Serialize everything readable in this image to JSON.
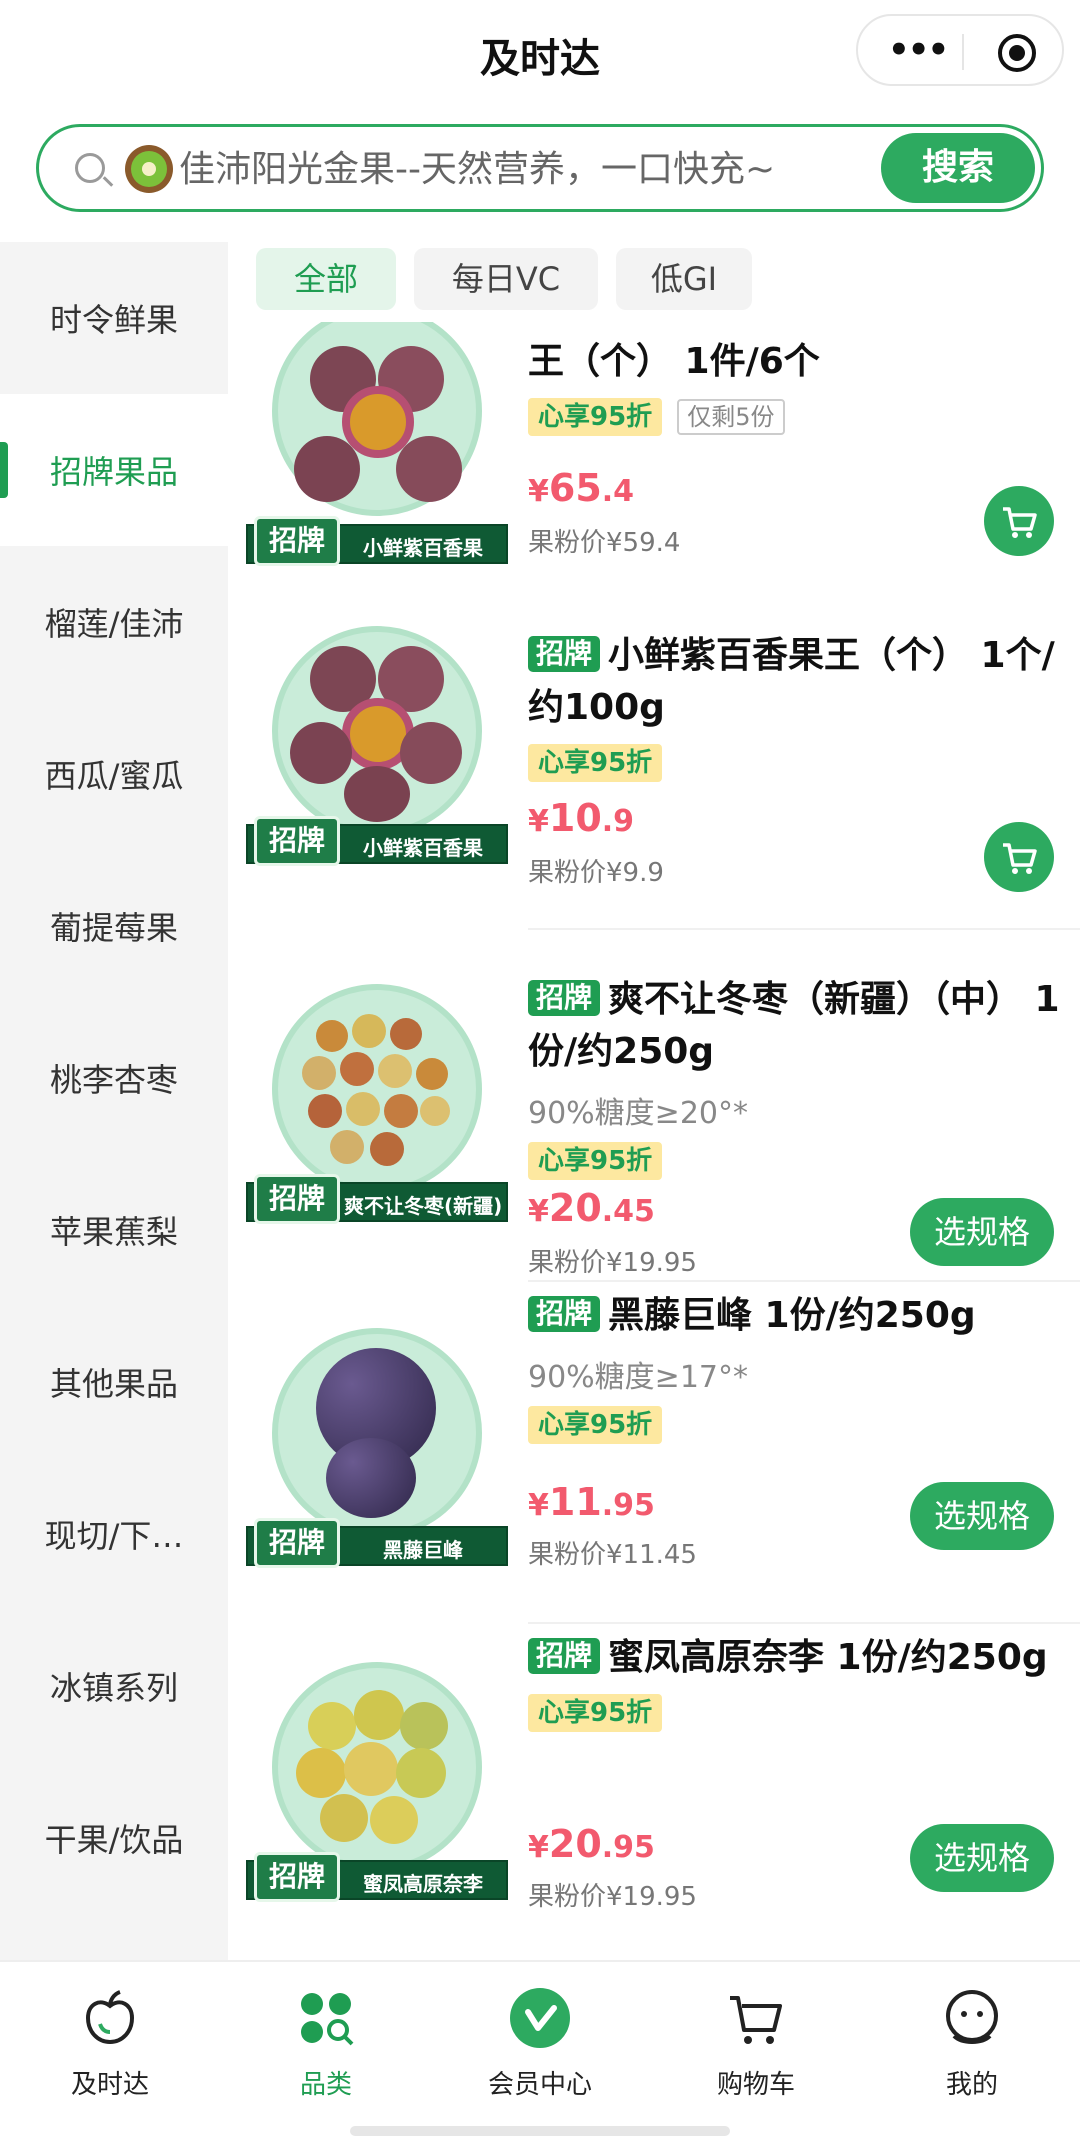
{
  "header": {
    "title": "及时达",
    "menu_icon": "more-dots-icon",
    "target_icon": "mini-program-close-icon"
  },
  "search": {
    "placeholder": "佳沛阳光金果--天然营养，一口快充~",
    "button_label": "搜索",
    "promo_icon": "kiwi-icon"
  },
  "sidebar": {
    "items": [
      {
        "label": "时令鲜果"
      },
      {
        "label": "招牌果品",
        "active": true
      },
      {
        "label": "榴莲/佳沛"
      },
      {
        "label": "西瓜/蜜瓜"
      },
      {
        "label": "葡提莓果"
      },
      {
        "label": "桃李杏枣"
      },
      {
        "label": "苹果蕉梨"
      },
      {
        "label": "其他果品"
      },
      {
        "label": "现切/下…"
      },
      {
        "label": "冰镇系列"
      },
      {
        "label": "干果/饮品"
      }
    ]
  },
  "filters": [
    {
      "label": "全部",
      "active": true
    },
    {
      "label": "每日VC"
    },
    {
      "label": "低GI"
    }
  ],
  "colors": {
    "brand_green": "#2daa60",
    "price_red": "#f25a6e",
    "discount_bg": "#fde8a0"
  },
  "products": [
    {
      "badge": "",
      "title": "王（个） 1件/6个",
      "sugar": "",
      "discount": "心享95折",
      "stock": "仅剩5份",
      "price_currency": "¥",
      "price_int": "65",
      "price_dec": ".4",
      "member_price": "果粉价¥59.4",
      "thumb_badge": "招牌",
      "thumb_name": "小鲜紫百香果",
      "action": "cart",
      "action_label": ""
    },
    {
      "badge": "招牌",
      "title": "小鲜紫百香果王（个） 1个/约100g",
      "sugar": "",
      "discount": "心享95折",
      "stock": "",
      "price_currency": "¥",
      "price_int": "10",
      "price_dec": ".9",
      "member_price": "果粉价¥9.9",
      "thumb_badge": "招牌",
      "thumb_name": "小鲜紫百香果",
      "action": "cart",
      "action_label": ""
    },
    {
      "badge": "招牌",
      "title": "爽不让冬枣（新疆）（中） 1份/约250g",
      "sugar": "90%糖度≥20°*",
      "discount": "心享95折",
      "stock": "",
      "price_currency": "¥",
      "price_int": "20",
      "price_dec": ".45",
      "member_price": "果粉价¥19.95",
      "thumb_badge": "招牌",
      "thumb_name": "爽不让冬枣(新疆)",
      "action": "spec",
      "action_label": "选规格"
    },
    {
      "badge": "招牌",
      "title": "黑藤巨峰 1份/约250g",
      "sugar": "90%糖度≥17°*",
      "discount": "心享95折",
      "stock": "",
      "price_currency": "¥",
      "price_int": "11",
      "price_dec": ".95",
      "member_price": "果粉价¥11.45",
      "thumb_badge": "招牌",
      "thumb_name": "黑藤巨峰",
      "action": "spec",
      "action_label": "选规格"
    },
    {
      "badge": "招牌",
      "title": "蜜凤高原奈李 1份/约250g",
      "sugar": "",
      "discount": "心享95折",
      "stock": "",
      "price_currency": "¥",
      "price_int": "20",
      "price_dec": ".95",
      "member_price": "果粉价¥19.95",
      "thumb_badge": "招牌",
      "thumb_name": "蜜凤高原奈李",
      "action": "spec",
      "action_label": "选规格"
    }
  ],
  "bottom_nav": [
    {
      "label": "及时达",
      "icon": "apple-icon"
    },
    {
      "label": "品类",
      "icon": "category-icon",
      "active": true
    },
    {
      "label": "会员中心",
      "icon": "member-icon"
    },
    {
      "label": "购物车",
      "icon": "cart-icon"
    },
    {
      "label": "我的",
      "icon": "profile-icon"
    }
  ]
}
